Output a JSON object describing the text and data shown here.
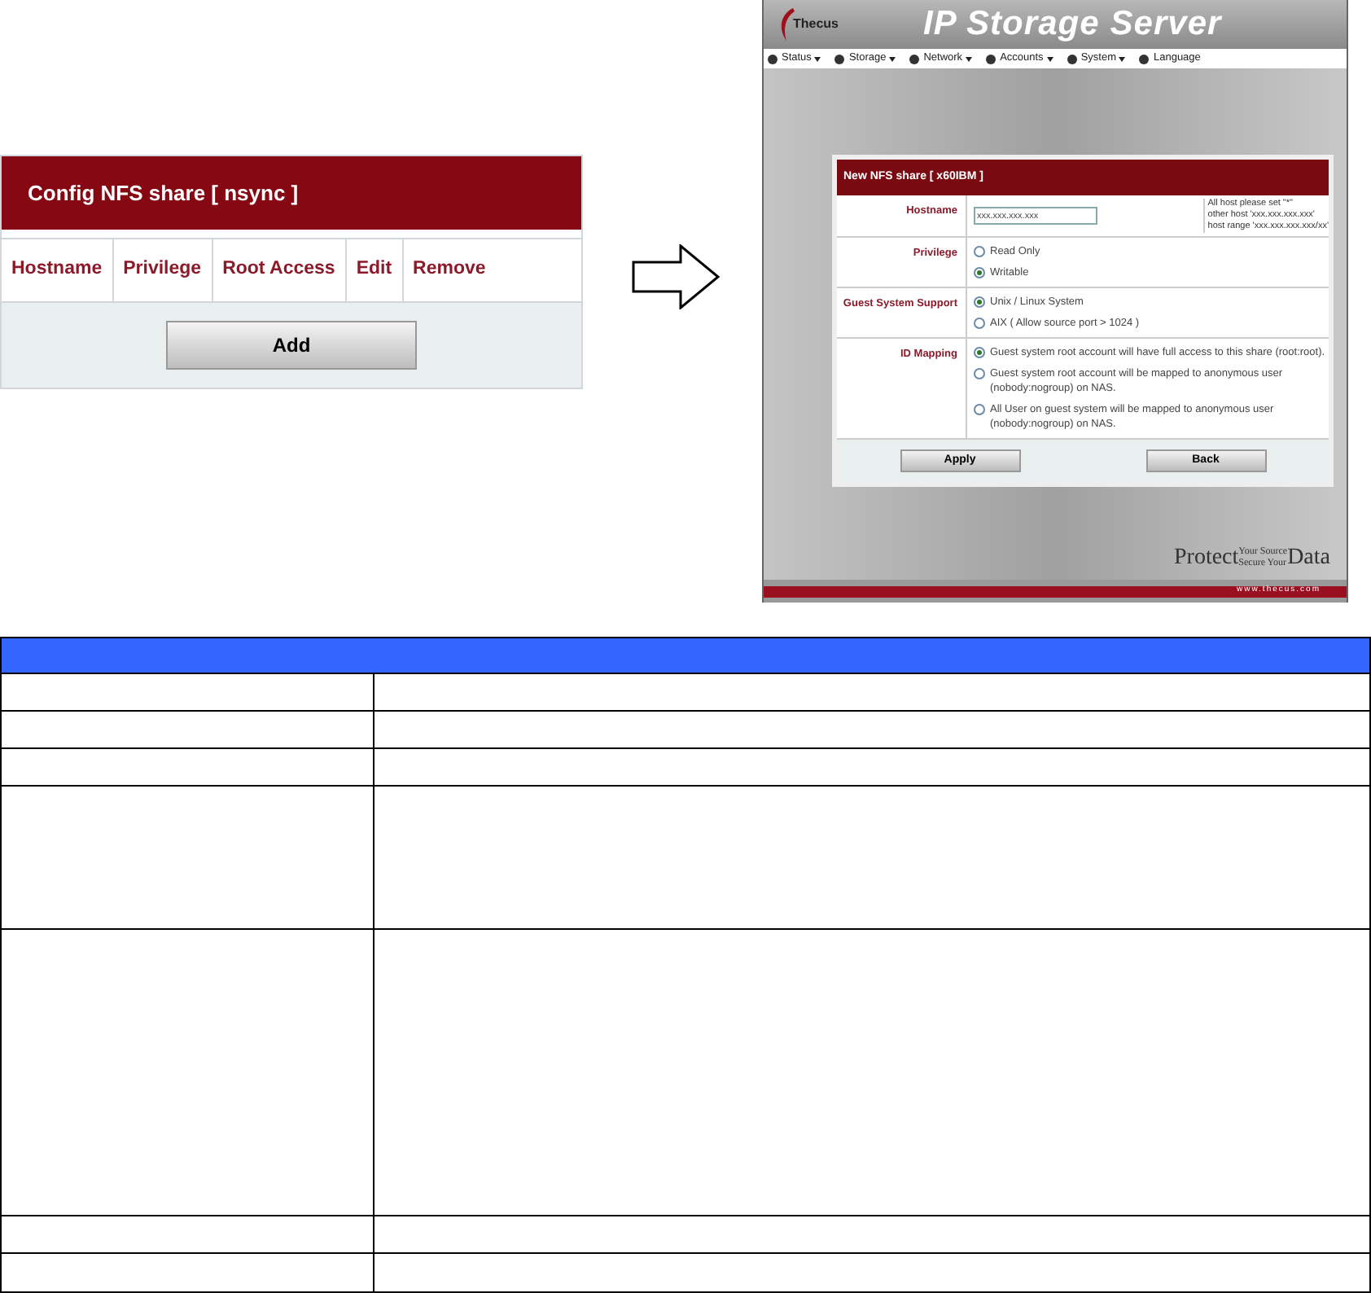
{
  "nfs_config_panel": {
    "title": "Config NFS share [ nsync ]",
    "columns": [
      "Hostname",
      "Privilege",
      "Root Access",
      "Edit",
      "Remove"
    ],
    "add_button": "Add"
  },
  "screenshot": {
    "brand": "Thecus",
    "title": "IP Storage Server",
    "menu": [
      {
        "label": "Status",
        "dropdown": true
      },
      {
        "label": "Storage",
        "dropdown": true
      },
      {
        "label": "Network",
        "dropdown": true
      },
      {
        "label": "Accounts",
        "dropdown": true
      },
      {
        "label": "System",
        "dropdown": true
      },
      {
        "label": "Language",
        "dropdown": false
      }
    ],
    "form": {
      "title": "New NFS share [ x60IBM ]",
      "fields": [
        {
          "kind": "text",
          "label": "Hostname",
          "value": "xxx.xxx.xxx.xxx",
          "hints": [
            "All host please set \"*\"",
            "other host 'xxx.xxx.xxx.xxx'",
            "host range 'xxx.xxx.xxx.xxx/xx'"
          ]
        },
        {
          "kind": "radio",
          "label": "Privilege",
          "options": [
            {
              "label": "Read Only",
              "selected": false
            },
            {
              "label": "Writable",
              "selected": true
            }
          ]
        },
        {
          "kind": "radio",
          "label": "Guest System Support",
          "options": [
            {
              "label": "Unix / Linux System",
              "selected": true
            },
            {
              "label": "AIX ( Allow source port > 1024 )",
              "selected": false
            }
          ]
        },
        {
          "kind": "radio",
          "label": "ID Mapping",
          "options": [
            {
              "label": "Guest system root account will have full access to this share (root:root).",
              "selected": true
            },
            {
              "label": "Guest system root account will be mapped to anonymous user (nobody:nogroup) on NAS.",
              "selected": false
            },
            {
              "label": "All User on guest system will be mapped to anonymous user (nobody:nogroup) on NAS.",
              "selected": false
            }
          ]
        }
      ],
      "buttons": [
        "Apply",
        "Back"
      ]
    },
    "slogan": {
      "protect": "Protect",
      "your_source": "Your Source",
      "secure_your": "Secure Your",
      "data": "Data"
    },
    "url": "www.thecus.com"
  }
}
